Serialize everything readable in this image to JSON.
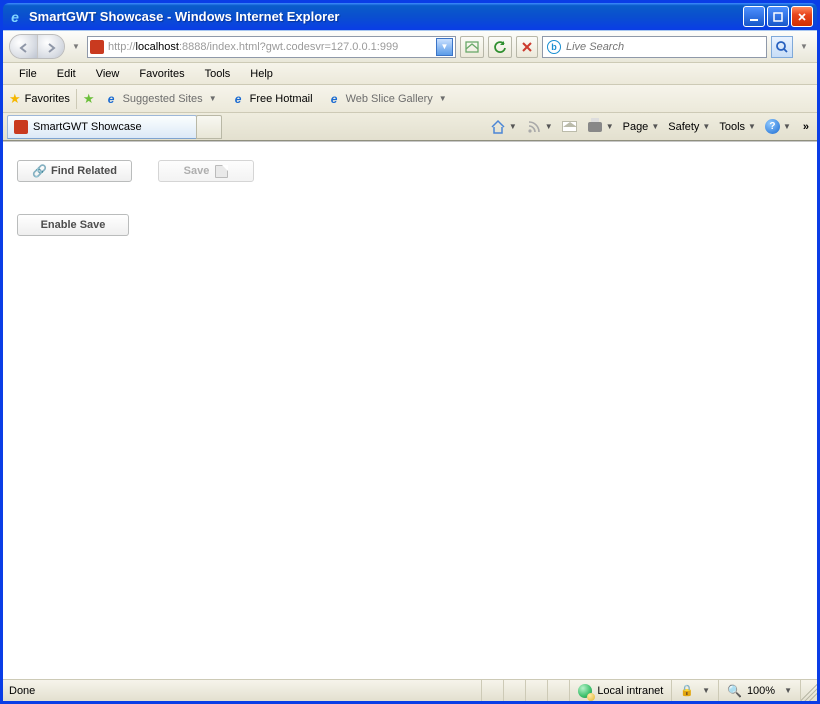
{
  "window": {
    "title": "SmartGWT Showcase - Windows Internet Explorer"
  },
  "nav": {
    "url_prefix": "http://",
    "url_host": "localhost",
    "url_suffix": ":8888/index.html?gwt.codesvr=127.0.0.1:999",
    "search_placeholder": "Live Search"
  },
  "menu": {
    "items": [
      "File",
      "Edit",
      "View",
      "Favorites",
      "Tools",
      "Help"
    ]
  },
  "favbar": {
    "label": "Favorites",
    "suggested": "Suggested Sites",
    "hotmail": "Free Hotmail",
    "webslice": "Web Slice Gallery"
  },
  "tabs": {
    "active": "SmartGWT Showcase"
  },
  "cmd": {
    "page": "Page",
    "safety": "Safety",
    "tools": "Tools"
  },
  "content": {
    "find_related": "Find Related",
    "save": "Save",
    "enable_save": "Enable Save"
  },
  "status": {
    "done": "Done",
    "zone": "Local intranet",
    "zoom": "100%"
  }
}
